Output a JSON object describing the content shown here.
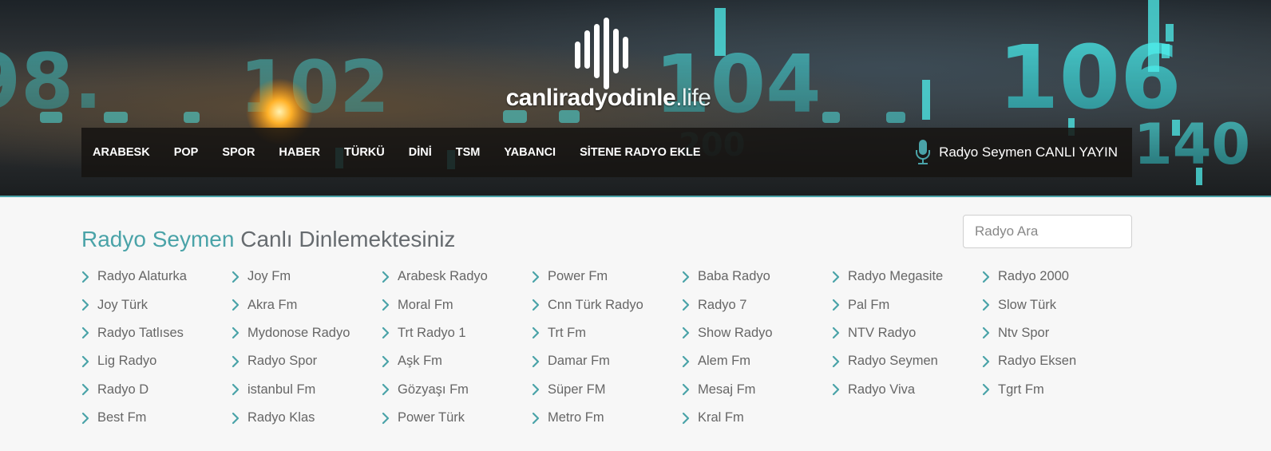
{
  "brand": {
    "name": "canliradyodinle",
    "tld": ".life"
  },
  "nav": {
    "items": [
      {
        "label": "ARABESK"
      },
      {
        "label": "POP"
      },
      {
        "label": "SPOR"
      },
      {
        "label": "HABER"
      },
      {
        "label": "TÜRKÜ"
      },
      {
        "label": "DİNİ"
      },
      {
        "label": "TSM"
      },
      {
        "label": "YABANCI"
      },
      {
        "label": "SİTENE RADYO EKLE"
      }
    ],
    "live_label": "Radyo Seymen CANLI YAYIN",
    "live_icon": "microphone-icon"
  },
  "search": {
    "placeholder": "Radyo Ara",
    "value": ""
  },
  "heading": {
    "highlight": "Radyo Seymen",
    "rest": " Canlı Dinlemektesiniz"
  },
  "stations": [
    {
      "name": "Radyo Alaturka"
    },
    {
      "name": "Joy Fm"
    },
    {
      "name": "Arabesk Radyo"
    },
    {
      "name": "Power Fm"
    },
    {
      "name": "Baba Radyo"
    },
    {
      "name": "Radyo Megasite"
    },
    {
      "name": "Radyo 2000"
    },
    {
      "name": "Joy Türk"
    },
    {
      "name": "Akra Fm"
    },
    {
      "name": "Moral Fm"
    },
    {
      "name": "Cnn Türk Radyo"
    },
    {
      "name": "Radyo 7"
    },
    {
      "name": "Pal Fm"
    },
    {
      "name": "Slow Türk"
    },
    {
      "name": "Radyo Tatlıses"
    },
    {
      "name": "Mydonose Radyo"
    },
    {
      "name": "Trt Radyo 1"
    },
    {
      "name": "Trt Fm"
    },
    {
      "name": "Show Radyo"
    },
    {
      "name": "NTV Radyo"
    },
    {
      "name": "Ntv Spor"
    },
    {
      "name": "Lig Radyo"
    },
    {
      "name": "Radyo Spor"
    },
    {
      "name": "Aşk Fm"
    },
    {
      "name": "Damar Fm"
    },
    {
      "name": "Alem Fm"
    },
    {
      "name": "Radyo Seymen"
    },
    {
      "name": "Radyo Eksen"
    },
    {
      "name": "Radyo D"
    },
    {
      "name": "istanbul Fm"
    },
    {
      "name": "Gözyaşı Fm"
    },
    {
      "name": "Süper FM"
    },
    {
      "name": "Mesaj Fm"
    },
    {
      "name": "Radyo Viva"
    },
    {
      "name": "Tgrt Fm"
    },
    {
      "name": "Best Fm"
    },
    {
      "name": "Radyo Klas"
    },
    {
      "name": "Power Türk"
    },
    {
      "name": "Metro Fm"
    },
    {
      "name": "Kral Fm"
    }
  ],
  "colors": {
    "accent": "#4aa3a8",
    "text": "#666666",
    "navbar_bg": "#161412",
    "page_bg": "#f7f7f7"
  }
}
